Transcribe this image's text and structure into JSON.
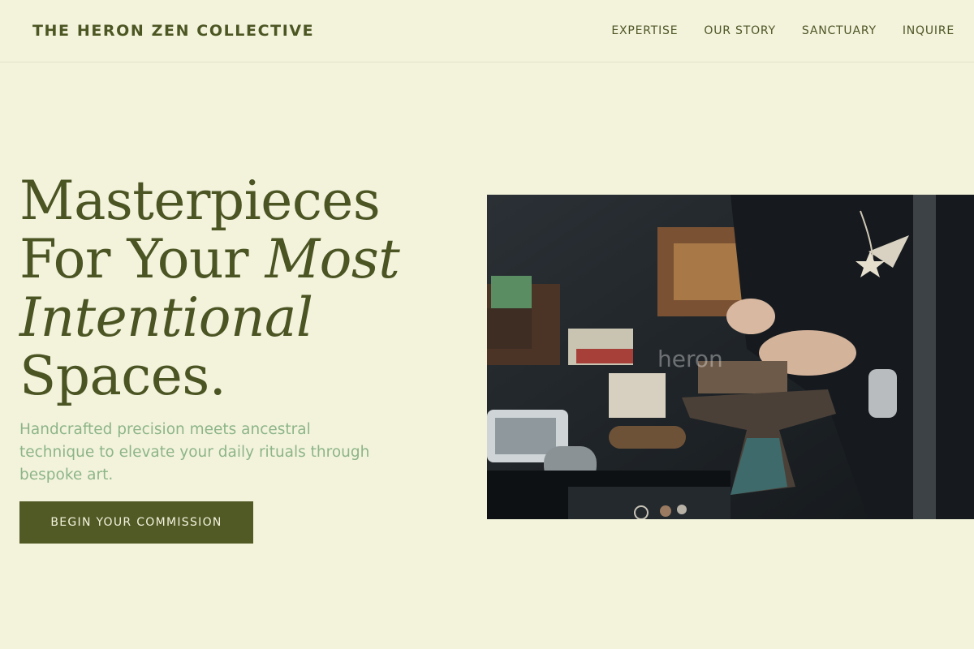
{
  "header": {
    "brand": "THE HERON ZEN COLLECTIVE",
    "nav": [
      "EXPERTISE",
      "OUR STORY",
      "SANCTUARY",
      "INQUIRE"
    ]
  },
  "hero": {
    "title_line1": "Masterpieces",
    "title_line2_plain": "For Your ",
    "title_line2_italic": "Most",
    "title_line3_italic": "Intentional",
    "title_line4": "Spaces.",
    "subtitle": "Handcrafted precision meets ancestral technique to elevate your daily rituals through bespoke art.",
    "cta_label": "BEGIN YOUR COMMISSION"
  },
  "photo": {
    "watermark": "heron"
  },
  "colors": {
    "background": "#f3f3dc",
    "primary": "#4b5423",
    "accent": "#8db588",
    "button": "#515925"
  }
}
